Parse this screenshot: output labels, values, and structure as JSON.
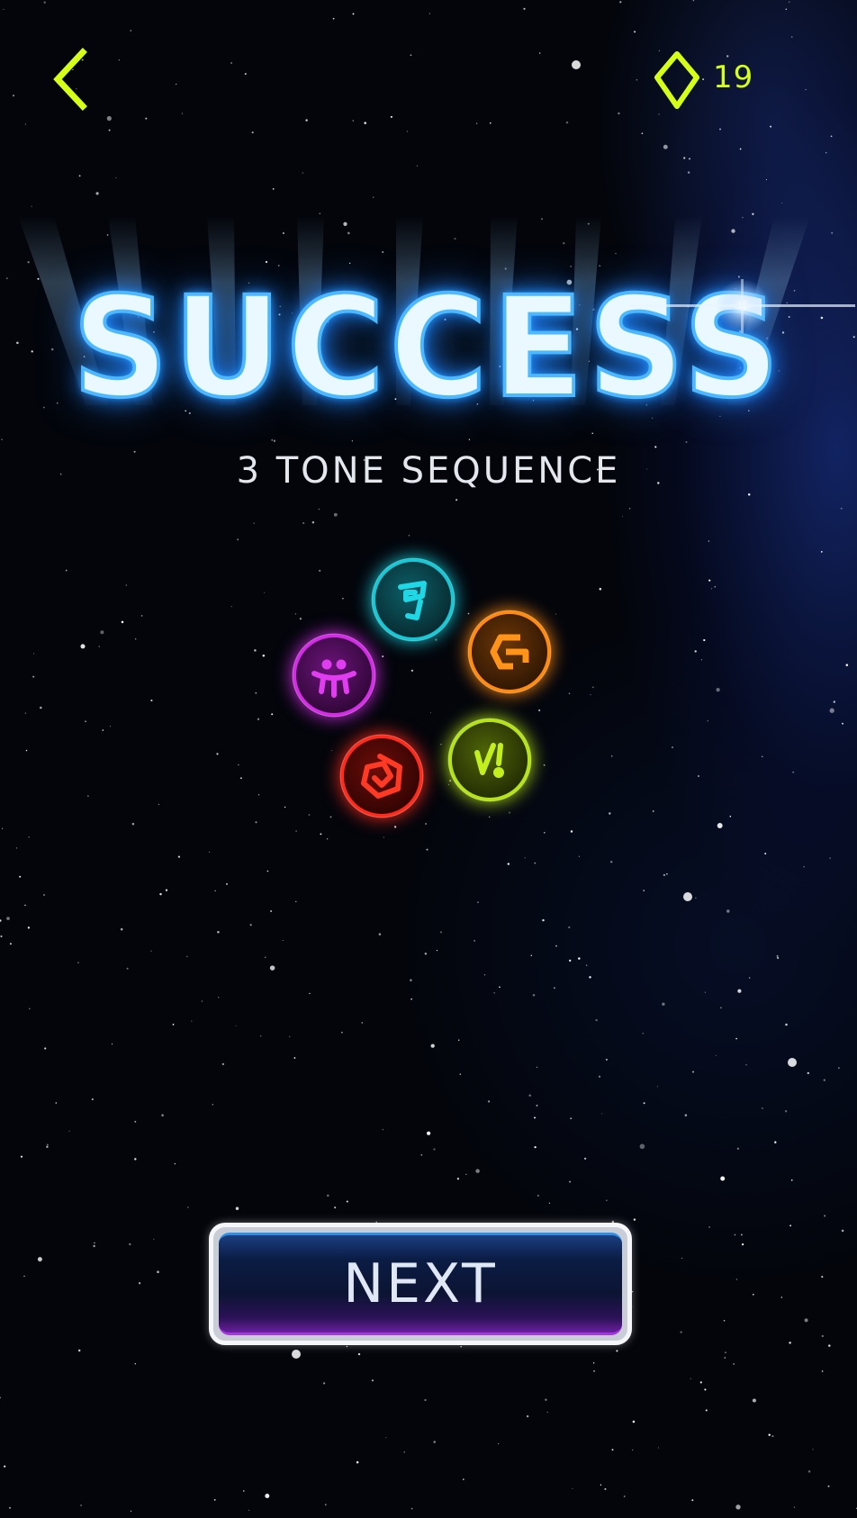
{
  "header": {
    "back_icon": "chevron-left-icon",
    "gem_icon": "gem-icon",
    "gem_count": "19",
    "accent_color": "#d6ff16"
  },
  "result": {
    "title": "SUCCESS",
    "subtitle": "3 TONE SEQUENCE",
    "title_glow_color": "#3aa8ff"
  },
  "tone_orbs": [
    {
      "id": "cyan",
      "color": "#18c7d6",
      "icon": "spiral-glyph-icon"
    },
    {
      "id": "orange",
      "color": "#ff8a10",
      "icon": "bracket-glyph-icon"
    },
    {
      "id": "purple",
      "color": "#d32be6",
      "icon": "trident-glyph-icon"
    },
    {
      "id": "green",
      "color": "#b6e316",
      "icon": "slash-glyph-icon"
    },
    {
      "id": "red",
      "color": "#ff2a1a",
      "icon": "square-spiral-glyph-icon"
    }
  ],
  "actions": {
    "next_label": "NEXT"
  }
}
